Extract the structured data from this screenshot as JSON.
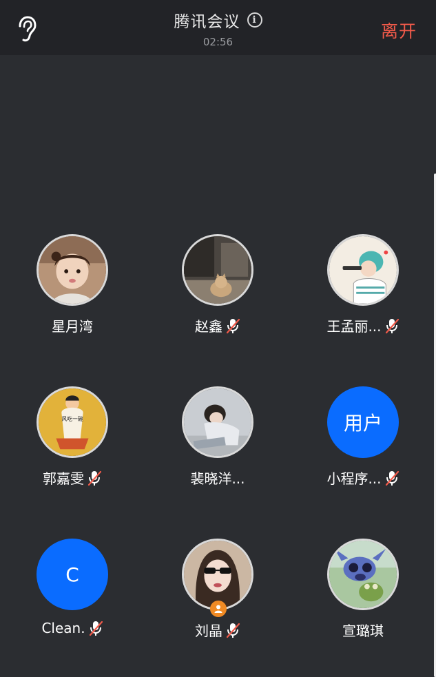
{
  "header": {
    "title": "腾讯会议",
    "timer": "02:56",
    "leave_label": "离开",
    "info_icon": "info-icon",
    "ear_icon": "ear-icon"
  },
  "participants": [
    {
      "name": "星月湾",
      "mic_muted": false,
      "avatar": "photo-child"
    },
    {
      "name": "赵鑫",
      "mic_muted": true,
      "avatar": "photo-cat"
    },
    {
      "name": "王孟丽...",
      "mic_muted": true,
      "avatar": "illustration-girl"
    },
    {
      "name": "郭嘉雯",
      "mic_muted": true,
      "avatar": "illustration-rice"
    },
    {
      "name": "裴晓洋...",
      "mic_muted": false,
      "avatar": "photo-girl-sitting"
    },
    {
      "name": "小程序...",
      "mic_muted": true,
      "avatar_text": "用户"
    },
    {
      "name": "Clean.",
      "mic_muted": true,
      "avatar_text": "C"
    },
    {
      "name": "刘晶",
      "mic_muted": true,
      "avatar": "photo-girl-sunglasses",
      "host": true
    },
    {
      "name": "宣璐琪",
      "mic_muted": false,
      "avatar": "illustration-stitch"
    }
  ],
  "avatar_text": {
    "rice_sign": "风吃一碗"
  },
  "colors": {
    "background": "#2b2d31",
    "topbar": "#222327",
    "leave": "#f25a4a",
    "letter_avatar": "#0a6cff",
    "host_badge": "#f08a24"
  }
}
